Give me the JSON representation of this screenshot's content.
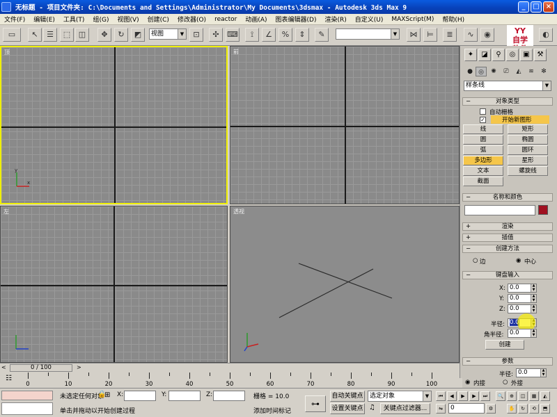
{
  "window": {
    "title": "无标题  - 项目文件夹: C:\\Documents and Settings\\Administrator\\My Documents\\3dsmax  - Autodesk 3ds Max 9",
    "min_btn": "_",
    "max_btn": "□",
    "close_btn": "×"
  },
  "menu": [
    "文件(F)",
    "编辑(E)",
    "工具(T)",
    "组(G)",
    "视图(V)",
    "创建(C)",
    "修改器(O)",
    "reactor",
    "动画(A)",
    "图表编辑器(D)",
    "渲染(R)",
    "自定义(U)",
    "MAXScript(M)",
    "帮助(H)"
  ],
  "toolbar": {
    "view_select": "视图",
    "named_selection": "",
    "brand_logo": "YY\n自学\n软件"
  },
  "viewports": [
    {
      "label": "顶",
      "name": "top",
      "active": true
    },
    {
      "label": "前",
      "name": "front",
      "active": false
    },
    {
      "label": "左",
      "name": "left",
      "active": false
    },
    {
      "label": "透视",
      "name": "perspective",
      "active": false
    }
  ],
  "panel": {
    "category_select": "样条线",
    "rollout_object_type": "对象类型",
    "auto_grid": "自动栅格",
    "start_new_shape": "开始新图形",
    "buttons": [
      "线",
      "矩形",
      "圆",
      "椭圆",
      "弧",
      "圆环",
      "多边形",
      "星形",
      "文本",
      "螺旋线",
      "截面"
    ],
    "active_button": "多边形",
    "rollout_name_color": "名称和颜色",
    "object_color": "#a01020",
    "rollout_rendering": "渲染",
    "rollout_interpolation": "插值",
    "rollout_creation_method": "创建方法",
    "radio_edge": "边",
    "radio_center": "中心",
    "rollout_keyboard": "键盘输入",
    "kb_x_label": "X:",
    "kb_x": "0.0",
    "kb_y_label": "Y:",
    "kb_y": "0.0",
    "kb_z_label": "Z:",
    "kb_z": "0.0",
    "kb_radius_label": "半径:",
    "kb_radius": "0.0",
    "kb_corner_label": "角半径:",
    "kb_corner": "0.0",
    "create_btn": "创建",
    "rollout_params": "参数",
    "param_radius_label": "半径:",
    "param_radius": "0.0",
    "param_inscribed": "内接",
    "param_circumscribed": "外接"
  },
  "timeline": {
    "frame_display": "0 / 100",
    "ticks": [
      "0",
      "10",
      "20",
      "30",
      "40",
      "50",
      "60",
      "70",
      "80",
      "90",
      "100"
    ]
  },
  "status": {
    "selection": "未选定任何对象",
    "prompt": "单击并拖动以开始创建过程",
    "x_label": "X:",
    "x_value": "",
    "y_label": "Y:",
    "y_value": "",
    "z_label": "Z:",
    "z_value": "",
    "grid": "栅格 = 10.0",
    "add_time_tag": "添加时间标记",
    "auto_key": "自动关键点",
    "set_key": "设置关键点",
    "key_filter_select": "选定对象",
    "key_filters": "关键点过滤器...",
    "frame": "0"
  }
}
